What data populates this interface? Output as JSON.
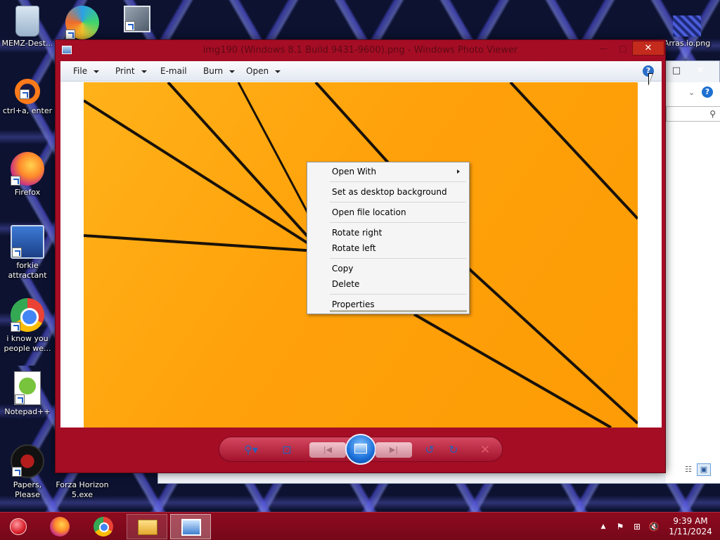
{
  "desktop": {
    "icons": [
      {
        "label": "MEMZ-Dest...",
        "icon": "recycle-bin-icon"
      },
      {
        "label": "",
        "icon": "edge-icon"
      },
      {
        "label": "",
        "icon": "stacked-windows-icon"
      },
      {
        "label": "ctrl+a, enter",
        "icon": "orange-ring-icon"
      },
      {
        "label": "Firefox",
        "icon": "firefox-icon"
      },
      {
        "label": "forkie attractant",
        "icon": "settings-computer-icon"
      },
      {
        "label": "i know you people we...",
        "icon": "chrome-icon"
      },
      {
        "label": "Notepad++",
        "icon": "notepad-plus-plus-icon"
      },
      {
        "label": "Papers, Please",
        "icon": "papers-please-icon"
      },
      {
        "label": "Forza Horizon 5.exe",
        "icon": ""
      },
      {
        "label": "Arras.io.png",
        "icon": "image-file-icon"
      }
    ]
  },
  "explorer_bg": {
    "maximize": "□",
    "close": "✕",
    "chevron": "⌄",
    "help": "?",
    "search_icon": "⚲",
    "view_details": "☷",
    "view_tiles": "▣"
  },
  "viewer": {
    "title": "img190 (Windows 8.1 Build 9431-9600).png - Windows Photo Viewer",
    "minimize": "—",
    "maximize": "□",
    "close": "✕",
    "menu": [
      {
        "label": "File",
        "has_caret": true
      },
      {
        "label": "Print",
        "has_caret": true
      },
      {
        "label": "E-mail",
        "has_caret": false
      },
      {
        "label": "Burn",
        "has_caret": true
      },
      {
        "label": "Open",
        "has_caret": true
      }
    ],
    "help": "?",
    "controls": {
      "zoom": "⚲▾",
      "fit": "⊡",
      "previous": "|◀",
      "next": "▶|",
      "rotate_left": "↺",
      "rotate_right": "↻",
      "delete": "✕"
    }
  },
  "context_menu": {
    "items": [
      {
        "label": "Open With",
        "submenu": true
      },
      {
        "label": "Set as desktop background",
        "submenu": false
      },
      {
        "label": "Open file location",
        "submenu": false
      },
      {
        "label": "Rotate right",
        "submenu": false
      },
      {
        "label": "Rotate left",
        "submenu": false
      },
      {
        "label": "Copy",
        "submenu": false
      },
      {
        "label": "Delete",
        "submenu": false
      },
      {
        "label": "Properties",
        "submenu": false
      }
    ]
  },
  "taskbar": {
    "apps": [
      "start",
      "firefox",
      "chrome",
      "file-explorer",
      "photo-viewer"
    ],
    "tray": {
      "show_hidden": "▲",
      "flag": "⚑",
      "network": "⊞",
      "volume": "🔇"
    },
    "time": "9:39 AM",
    "date": "1/11/2024"
  },
  "colors": {
    "accent": "#a50d25",
    "taskbar": "#8e0a1f",
    "photo_orange": "#ffa10a"
  }
}
